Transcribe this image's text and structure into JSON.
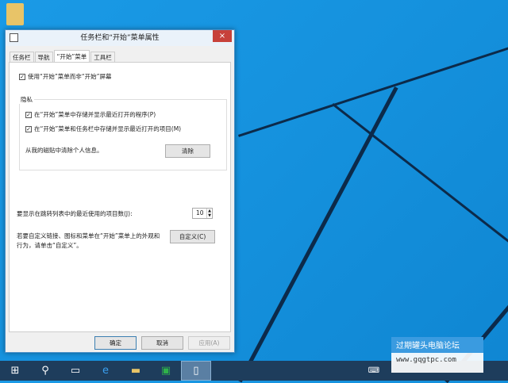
{
  "dialog": {
    "title": "任务栏和“开始”菜单属性",
    "close": "×",
    "tabs": [
      "任务栏",
      "导航",
      "“开始”菜单",
      "工具栏"
    ],
    "use_start_menu": "使用“开始”菜单而非“开始”屏幕",
    "privacy": {
      "label": "隐私",
      "store_programs": "在“开始”菜单中存储并显示最近打开的程序(P)",
      "store_items": "在“开始”菜单和任务栏中存储并显示最近打开的项目(M)",
      "clear_text": "从我的磁贴中清除个人信息。",
      "clear_button": "清除"
    },
    "jumplist_label": "要显示在跳转列表中的最近使用的项目数(J):",
    "jumplist_value": "10",
    "customize_text_1": "若要自定义链接、图标和菜单在“开始”菜单上的外观和",
    "customize_text_2": "行为，请单击“自定义”。",
    "customize_button": "自定义(C)",
    "ok": "确定",
    "cancel": "取消",
    "apply": "应用(A)"
  },
  "watermark": {
    "name": "过期罐头电脑论坛",
    "url": "www.gqgtpc.com"
  }
}
